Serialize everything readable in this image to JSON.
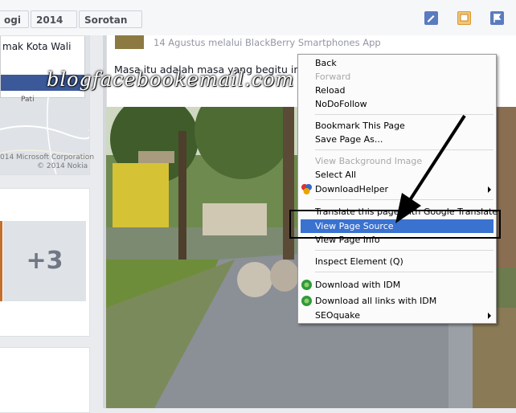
{
  "filters": [
    {
      "label": "ogi"
    },
    {
      "label": "2014"
    },
    {
      "label": "Sorotan"
    }
  ],
  "icons": {
    "edit": "pencil-icon",
    "photo": "photo-icon",
    "flag": "flag-icon"
  },
  "sidebar": {
    "map_title": "mak Kota Wali",
    "map_place": "Pati",
    "map_copyright_1": "014 Microsoft Corporation",
    "map_copyright_2": "© 2014 Nokia",
    "more_count": "+3"
  },
  "post": {
    "meta": "14 Agustus melalui BlackBerry Smartphones App",
    "text": "Masa itu adalah masa yang begitu in"
  },
  "watermark": "blogfacebookemail.com",
  "context_menu": {
    "items": [
      {
        "label": "Back"
      },
      {
        "label": "Forward"
      },
      {
        "label": "Reload"
      },
      {
        "label": "NoDoFollow"
      },
      {
        "label": "Bookmark This Page"
      },
      {
        "label": "Save Page As..."
      },
      {
        "label": "View Background Image"
      },
      {
        "label": "Select All"
      },
      {
        "label": "DownloadHelper"
      },
      {
        "label": "Translate this page with Google Translate"
      },
      {
        "label": "View Page Source"
      },
      {
        "label": "View Page Info"
      },
      {
        "label": "Inspect Element (Q)"
      },
      {
        "label": "Download with IDM"
      },
      {
        "label": "Download all links with IDM"
      },
      {
        "label": "SEOquake"
      }
    ]
  },
  "colors": {
    "menu_highlight": "#3a72d0",
    "annotation": "#000000"
  }
}
